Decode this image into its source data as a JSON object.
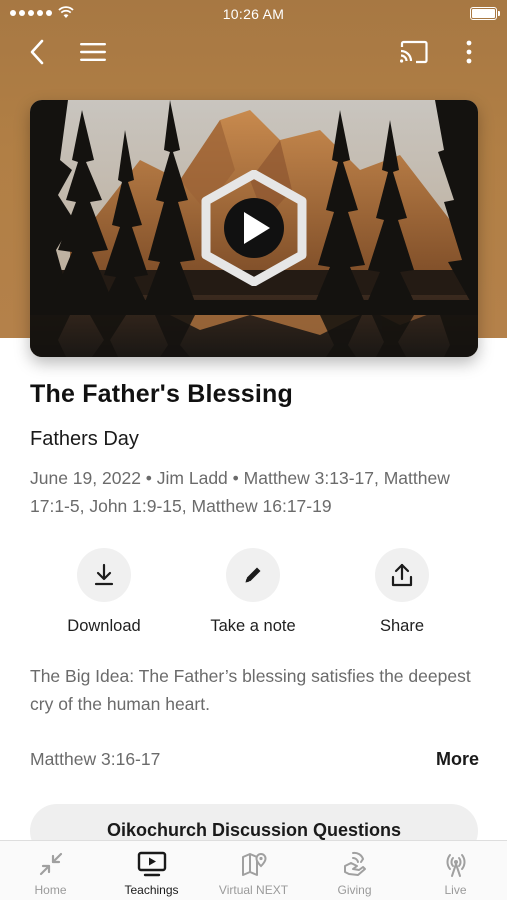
{
  "status_bar": {
    "time": "10:26 AM"
  },
  "sermon": {
    "title": "The Father's Blessing",
    "subtitle": "Fathers Day",
    "meta": "June 19, 2022 • Jim Ladd • Matthew 3:13-17, Matthew 17:1-5, John 1:9-15, Matthew 16:17-19",
    "big_idea": "The Big Idea: The Father’s blessing satisfies the deepest cry of the human heart.",
    "scripture": "Matthew 3:16-17",
    "more_label": "More",
    "discussion_label": "Oikochurch Discussion Questions"
  },
  "actions": {
    "download": "Download",
    "note": "Take a note",
    "share": "Share"
  },
  "tabs": {
    "home": "Home",
    "teachings": "Teachings",
    "virtual": "Virtual NEXT",
    "giving": "Giving",
    "live": "Live"
  },
  "icons": {
    "back": "chevron-left-icon",
    "menu": "hamburger-icon",
    "cast": "cast-icon",
    "overflow": "more-vertical-icon",
    "play": "play-icon",
    "download": "download-icon",
    "note": "pencil-icon",
    "share": "share-icon",
    "home": "collapse-arrows-icon",
    "teachings": "tv-play-icon",
    "virtual": "map-pin-icon",
    "giving": "giving-icon",
    "live": "broadcast-icon"
  },
  "colors": {
    "header_bg": "#b17f45",
    "accent_text": "#1a1a1a",
    "muted_text": "#6b6b6b",
    "button_bg": "#f0f0f0",
    "inactive_tab": "#9a9a9a"
  },
  "tab_bar": {
    "active": "teachings"
  }
}
